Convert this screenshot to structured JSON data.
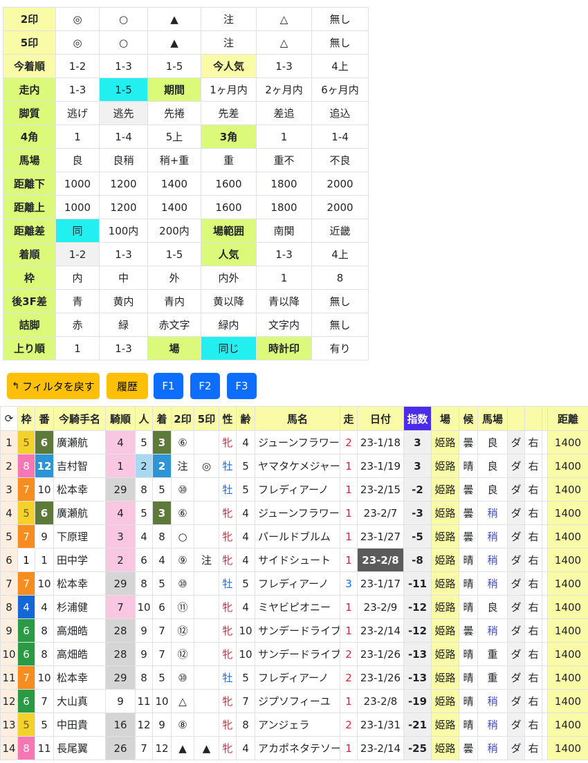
{
  "filter": {
    "rows": [
      {
        "name": "2印",
        "label_style": "lbl2",
        "cells": [
          {
            "t": "◎"
          },
          {
            "t": "○"
          },
          {
            "t": "▲"
          },
          {
            "t": "注"
          },
          {
            "t": "△"
          },
          {
            "t": "無し"
          }
        ]
      },
      {
        "name": "5印",
        "label_style": "lbl2",
        "cells": [
          {
            "t": "◎"
          },
          {
            "t": "○"
          },
          {
            "t": "▲"
          },
          {
            "t": "注"
          },
          {
            "t": "△"
          },
          {
            "t": "無し"
          }
        ]
      },
      {
        "name": "今着順",
        "label_style": "lbl2",
        "cells": [
          {
            "t": "1-2"
          },
          {
            "t": "1-3"
          },
          {
            "t": "1-5"
          },
          {
            "t": "今人気",
            "s": "lbl2"
          },
          {
            "t": "1-3"
          },
          {
            "t": "4上"
          }
        ]
      },
      {
        "name": "走内",
        "label_style": "lbl",
        "cells": [
          {
            "t": "1-3"
          },
          {
            "t": "1-5",
            "s": "sel"
          },
          {
            "t": "期間",
            "s": "lbl"
          },
          {
            "t": "1ヶ月内"
          },
          {
            "t": "2ヶ月内"
          },
          {
            "t": "6ヶ月内"
          }
        ]
      },
      {
        "name": "脚質",
        "label_style": "lbl",
        "cells": [
          {
            "t": "逃げ"
          },
          {
            "t": "逃先",
            "s": "gray"
          },
          {
            "t": "先捲"
          },
          {
            "t": "先差"
          },
          {
            "t": "差追"
          },
          {
            "t": "追込"
          }
        ]
      },
      {
        "name": "4角",
        "label_style": "lbl",
        "cells": [
          {
            "t": "1"
          },
          {
            "t": "1-4"
          },
          {
            "t": "5上"
          },
          {
            "t": "3角",
            "s": "lbl"
          },
          {
            "t": "1"
          },
          {
            "t": "1-4"
          }
        ]
      },
      {
        "name": "馬場",
        "label_style": "lbl",
        "cells": [
          {
            "t": "良"
          },
          {
            "t": "良稍"
          },
          {
            "t": "稍+重"
          },
          {
            "t": "重"
          },
          {
            "t": "重不"
          },
          {
            "t": "不良"
          }
        ]
      },
      {
        "name": "距離下",
        "label_style": "lbl",
        "cells": [
          {
            "t": "1000"
          },
          {
            "t": "1200"
          },
          {
            "t": "1400"
          },
          {
            "t": "1600"
          },
          {
            "t": "1800"
          },
          {
            "t": "2000"
          }
        ]
      },
      {
        "name": "距離上",
        "label_style": "lbl",
        "cells": [
          {
            "t": "1000"
          },
          {
            "t": "1200"
          },
          {
            "t": "1400"
          },
          {
            "t": "1600"
          },
          {
            "t": "1800"
          },
          {
            "t": "2000"
          }
        ]
      },
      {
        "name": "距離差",
        "label_style": "lbl",
        "cells": [
          {
            "t": "同",
            "s": "sel"
          },
          {
            "t": "100内"
          },
          {
            "t": "200内"
          },
          {
            "t": "場範囲",
            "s": "lbl"
          },
          {
            "t": "南関"
          },
          {
            "t": "近畿"
          }
        ]
      },
      {
        "name": "着順",
        "label_style": "lbl",
        "cells": [
          {
            "t": "1-2",
            "s": "gray"
          },
          {
            "t": "1-3"
          },
          {
            "t": "1-5"
          },
          {
            "t": "人気",
            "s": "lbl"
          },
          {
            "t": "1-3"
          },
          {
            "t": "4上"
          }
        ]
      },
      {
        "name": "枠",
        "label_style": "lbl",
        "cells": [
          {
            "t": "内"
          },
          {
            "t": "中"
          },
          {
            "t": "外"
          },
          {
            "t": "内外"
          },
          {
            "t": "1"
          },
          {
            "t": "8"
          }
        ]
      },
      {
        "name": "後3F差",
        "label_style": "lbl",
        "cells": [
          {
            "t": "青"
          },
          {
            "t": "黄内"
          },
          {
            "t": "青内"
          },
          {
            "t": "黄以降"
          },
          {
            "t": "青以降"
          },
          {
            "t": "無し"
          }
        ]
      },
      {
        "name": "詰脚",
        "label_style": "lbl",
        "cells": [
          {
            "t": "赤"
          },
          {
            "t": "緑"
          },
          {
            "t": "赤文字"
          },
          {
            "t": "緑内"
          },
          {
            "t": "文字内"
          },
          {
            "t": "無し"
          }
        ]
      },
      {
        "name": "上り順",
        "label_style": "lbl",
        "cells": [
          {
            "t": "1"
          },
          {
            "t": "1-3"
          },
          {
            "t": "場",
            "s": "lbl"
          },
          {
            "t": "同じ",
            "s": "sel"
          },
          {
            "t": "時計印",
            "s": "lbl"
          },
          {
            "t": "有り"
          }
        ]
      }
    ]
  },
  "buttons": {
    "back": "フィルタを戻す",
    "history": "履歴",
    "f1": "F1",
    "f2": "F2",
    "f3": "F3"
  },
  "table": {
    "headers": [
      "",
      "枠",
      "番",
      "今騎手名",
      "騎順",
      "人",
      "着",
      "2印",
      "5印",
      "性",
      "齢",
      "馬名",
      "走",
      "日付",
      "指数",
      "場",
      "候",
      "馬場",
      "",
      "",
      "距離"
    ],
    "rows": [
      {
        "n": "1",
        "waku": "5",
        "ban": "6",
        "jockey": "廣瀬航",
        "kijun": "4",
        "pop": "5",
        "chaku": "3",
        "m2": "⑥",
        "m5": "",
        "sex": "牝",
        "age": "4",
        "horse": "ジューンフラワー",
        "run": "2",
        "date": "23-1/18",
        "idx": "3",
        "venue": "姫路",
        "weather": "曇",
        "cond": "良",
        "surf": "ダ",
        "turn": "右",
        "dist": "1400"
      },
      {
        "n": "2",
        "waku": "8",
        "ban": "12",
        "jockey": "吉村智",
        "kijun": "1",
        "pop": "2",
        "chaku": "2",
        "m2": "注",
        "m5": "◎",
        "sex": "牡",
        "age": "5",
        "horse": "ヤマタケメジャー",
        "run": "1",
        "date": "23-1/19",
        "idx": "3",
        "venue": "姫路",
        "weather": "晴",
        "cond": "良",
        "surf": "ダ",
        "turn": "右",
        "dist": "1400"
      },
      {
        "n": "3",
        "waku": "7",
        "ban": "10",
        "jockey": "松本幸",
        "kijun": "29",
        "pop": "8",
        "chaku": "5",
        "m2": "⑩",
        "m5": "",
        "sex": "牡",
        "age": "5",
        "horse": "フレディアーノ",
        "run": "1",
        "date": "23-2/15",
        "idx": "-2",
        "venue": "姫路",
        "weather": "曇",
        "cond": "良",
        "surf": "ダ",
        "turn": "右",
        "dist": "1400"
      },
      {
        "n": "4",
        "waku": "5",
        "ban": "6",
        "jockey": "廣瀬航",
        "kijun": "4",
        "pop": "5",
        "chaku": "3",
        "m2": "⑥",
        "m5": "",
        "sex": "牝",
        "age": "4",
        "horse": "ジューンフラワー",
        "run": "1",
        "date": "23-2/7",
        "idx": "-3",
        "venue": "姫路",
        "weather": "曇",
        "cond": "稍",
        "surf": "ダ",
        "turn": "右",
        "dist": "1400"
      },
      {
        "n": "5",
        "waku": "7",
        "ban": "9",
        "jockey": "下原理",
        "kijun": "3",
        "pop": "4",
        "chaku": "8",
        "m2": "○",
        "m5": "",
        "sex": "牝",
        "age": "4",
        "horse": "パールドブルム",
        "run": "1",
        "date": "23-1/27",
        "idx": "-5",
        "venue": "姫路",
        "weather": "曇",
        "cond": "稍",
        "surf": "ダ",
        "turn": "右",
        "dist": "1400"
      },
      {
        "n": "6",
        "waku": "1",
        "ban": "1",
        "jockey": "田中学",
        "kijun": "2",
        "pop": "6",
        "chaku": "4",
        "m2": "⑨",
        "m5": "注",
        "sex": "牝",
        "age": "4",
        "horse": "サイドシュート",
        "run": "1",
        "date": "23-2/8",
        "idx": "-8",
        "venue": "姫路",
        "weather": "晴",
        "cond": "稍",
        "surf": "ダ",
        "turn": "右",
        "dist": "1400"
      },
      {
        "n": "7",
        "waku": "7",
        "ban": "10",
        "jockey": "松本幸",
        "kijun": "29",
        "pop": "8",
        "chaku": "5",
        "m2": "⑩",
        "m5": "",
        "sex": "牡",
        "age": "5",
        "horse": "フレディアーノ",
        "run": "3",
        "date": "23-1/17",
        "idx": "-11",
        "venue": "姫路",
        "weather": "晴",
        "cond": "稍",
        "surf": "ダ",
        "turn": "右",
        "dist": "1400"
      },
      {
        "n": "8",
        "waku": "4",
        "ban": "4",
        "jockey": "杉浦健",
        "kijun": "7",
        "pop": "10",
        "chaku": "6",
        "m2": "⑪",
        "m5": "",
        "sex": "牝",
        "age": "4",
        "horse": "ミヤビピオニー",
        "run": "1",
        "date": "23-2/9",
        "idx": "-12",
        "venue": "姫路",
        "weather": "晴",
        "cond": "良",
        "surf": "ダ",
        "turn": "右",
        "dist": "1400"
      },
      {
        "n": "9",
        "waku": "6",
        "ban": "8",
        "jockey": "高畑皓",
        "kijun": "28",
        "pop": "9",
        "chaku": "7",
        "m2": "⑫",
        "m5": "",
        "sex": "牝",
        "age": "10",
        "horse": "サンデードライブ",
        "run": "1",
        "date": "23-2/14",
        "idx": "-12",
        "venue": "姫路",
        "weather": "曇",
        "cond": "稍",
        "surf": "ダ",
        "turn": "右",
        "dist": "1400"
      },
      {
        "n": "10",
        "waku": "6",
        "ban": "8",
        "jockey": "高畑皓",
        "kijun": "28",
        "pop": "9",
        "chaku": "7",
        "m2": "⑫",
        "m5": "",
        "sex": "牝",
        "age": "10",
        "horse": "サンデードライブ",
        "run": "2",
        "date": "23-1/26",
        "idx": "-13",
        "venue": "姫路",
        "weather": "晴",
        "cond": "重",
        "surf": "ダ",
        "turn": "右",
        "dist": "1400"
      },
      {
        "n": "11",
        "waku": "7",
        "ban": "10",
        "jockey": "松本幸",
        "kijun": "29",
        "pop": "8",
        "chaku": "5",
        "m2": "⑩",
        "m5": "",
        "sex": "牡",
        "age": "5",
        "horse": "フレディアーノ",
        "run": "2",
        "date": "23-1/26",
        "idx": "-13",
        "venue": "姫路",
        "weather": "晴",
        "cond": "重",
        "surf": "ダ",
        "turn": "右",
        "dist": "1400"
      },
      {
        "n": "12",
        "waku": "6",
        "ban": "7",
        "jockey": "大山真",
        "kijun": "9",
        "pop": "11",
        "chaku": "10",
        "m2": "△",
        "m5": "",
        "sex": "牝",
        "age": "7",
        "horse": "ジプソフィーユ",
        "run": "1",
        "date": "23-2/8",
        "idx": "-19",
        "venue": "姫路",
        "weather": "晴",
        "cond": "稍",
        "surf": "ダ",
        "turn": "右",
        "dist": "1400"
      },
      {
        "n": "13",
        "waku": "5",
        "ban": "5",
        "jockey": "中田貴",
        "kijun": "16",
        "pop": "12",
        "chaku": "9",
        "m2": "⑧",
        "m5": "",
        "sex": "牝",
        "age": "8",
        "horse": "アンジェラ",
        "run": "2",
        "date": "23-1/31",
        "idx": "-21",
        "venue": "姫路",
        "weather": "晴",
        "cond": "稍",
        "surf": "ダ",
        "turn": "右",
        "dist": "1400"
      },
      {
        "n": "14",
        "waku": "8",
        "ban": "11",
        "jockey": "長尾翼",
        "kijun": "26",
        "pop": "7",
        "chaku": "12",
        "m2": "▲",
        "m5": "▲",
        "sex": "牝",
        "age": "4",
        "horse": "アカポネタテソーロ",
        "run": "1",
        "date": "23-2/14",
        "idx": "-25",
        "venue": "姫路",
        "weather": "曇",
        "cond": "稍",
        "surf": "ダ",
        "turn": "右",
        "dist": "1400"
      }
    ]
  },
  "colors": {
    "label_green": "#dcfa7a",
    "label_yellow": "#f9fba7",
    "selected": "#22f0f0",
    "btn_yellow": "#fec007",
    "btn_blue": "#0d6efd",
    "index_header": "#4b2ce8",
    "waku": {
      "1": "#ffffff",
      "4": "#1566d6",
      "5": "#f3d22b",
      "6": "#2a9a44",
      "7": "#f78d1e",
      "8": "#f776b4"
    }
  }
}
